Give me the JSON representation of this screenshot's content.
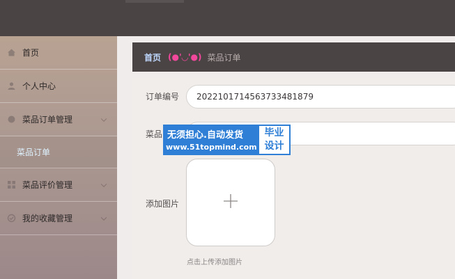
{
  "sidebar": {
    "items": [
      {
        "label": "首页",
        "icon": "home-icon"
      },
      {
        "label": "个人中心",
        "icon": "user-icon"
      },
      {
        "label": "菜品订单管理",
        "icon": "circle-icon",
        "expanded": true,
        "children": [
          {
            "label": "菜品订单",
            "active": true
          }
        ]
      },
      {
        "label": "菜品评价管理",
        "icon": "grid-icon"
      },
      {
        "label": "我的收藏管理",
        "icon": "check-circle-icon"
      }
    ]
  },
  "breadcrumb": {
    "home": "首页",
    "emoticon": "(●'◡'●)",
    "current": "菜品订单"
  },
  "form": {
    "order_number_label": "订单编号",
    "order_number_value": "2022101714563733481879",
    "dish_label": "菜品",
    "image_label": "添加图片",
    "upload_plus": "+",
    "upload_hint": "点击上传添加图片"
  },
  "watermark": {
    "line1": "无须担心.自动发货",
    "line2": "www.51topmind.com",
    "badge_line1": "毕业",
    "badge_line2": "设计"
  },
  "colors": {
    "header_bg": "#4b4444",
    "active_submenu_text": "#dff3ff",
    "breadcrumb_home": "#bfd8ff",
    "breadcrumb_emoticon": "#f1489c",
    "watermark_blue": "#2f7fd6"
  }
}
